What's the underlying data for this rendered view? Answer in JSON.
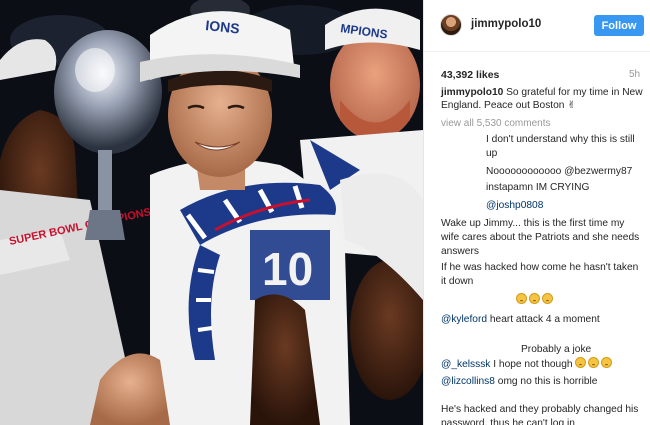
{
  "post": {
    "username": "jimmypolo10",
    "follow_label": "Follow",
    "likes": "43,392 likes",
    "time_ago": "5h",
    "caption_user": "jimmypolo10",
    "caption_text": "So grateful for my time in New England. Peace out Boston",
    "caption_emoji": "✌",
    "view_all": "view all 5,530 comments"
  },
  "photo": {
    "cap_left_text": "IONS",
    "cap_right_text": "MPIONS",
    "shirt_text": "SUPER BOWL CHAMPIONS",
    "background_color": "#0a0d14",
    "jersey_blue": "#1d3a8a",
    "jersey_red": "#c8102e"
  },
  "comments": [
    {
      "user": "",
      "text": "I don't understand why this is still up"
    },
    {
      "user": "",
      "text": "Noooooooooooo @bezwermy87"
    },
    {
      "user": "",
      "text": "instapamn IM CRYING"
    },
    {
      "user": "",
      "text": "@joshp0808"
    },
    {
      "user": "",
      "text": "Wake up Jimmy... this is the first time my wife cares about the Patriots and she needs answers"
    },
    {
      "user": "",
      "text": "If he was hacked how come he hasn't taken it down"
    },
    {
      "user": "",
      "text": ""
    },
    {
      "user": "@kyleford",
      "text": "heart attack 4 a moment"
    },
    {
      "user": "",
      "text": "Probably a joke"
    },
    {
      "user": "@_kelsssk",
      "text": "I hope not though"
    },
    {
      "user": "@lizcollins8",
      "text": "omg no this is horrible"
    },
    {
      "user": "",
      "text": "He's hacked and they probably changed his password, thus he can't log in"
    }
  ]
}
